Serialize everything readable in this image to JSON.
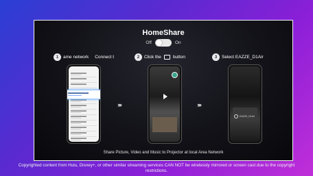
{
  "panel": {
    "title": "HomeShare",
    "toggle": {
      "off_label": "Off",
      "on_label": "On",
      "state": "on"
    },
    "steps": [
      {
        "num": "1",
        "text_a": "ame network",
        "text_b": "Connect t"
      },
      {
        "num": "2",
        "text_a": "Click the",
        "text_b": "button"
      },
      {
        "num": "3",
        "text_a": "Select  EAZZE_D1Air"
      }
    ],
    "phone3": {
      "device_name": "EAZZE_D1Air"
    },
    "arrows": "›››››",
    "caption": "Share Picture, Video and Music to Projector at local Area Network"
  },
  "notice": "Copyrighted content from Hulu, Disney+, or other similar streaming services CAN NOT be wirelessly mirrored or screen cast due to the copyright restrictions."
}
